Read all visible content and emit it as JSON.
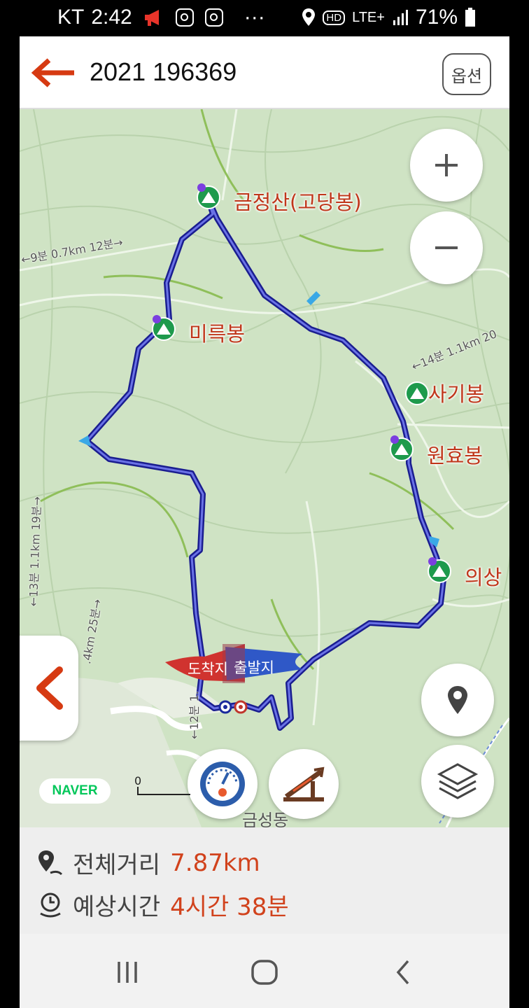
{
  "status_bar": {
    "carrier": "KT",
    "time": "2:42",
    "network": "LTE+",
    "hd": "HD",
    "battery": "71%"
  },
  "header": {
    "title": "2021 196369",
    "option_label": "옵션"
  },
  "map": {
    "peaks": [
      {
        "name": "금정산(고당봉)"
      },
      {
        "name": "미륵봉"
      },
      {
        "name": "사기봉"
      },
      {
        "name": "원효봉"
      },
      {
        "name": "의상"
      }
    ],
    "trail_labels": [
      "←9분 0.7km 12분→",
      "←14분 1.1km 20",
      "←13분 1.1km 19분→",
      ".4km 25분→",
      "←12분 1."
    ],
    "arrival_label": "도착지",
    "departure_label": "출발지",
    "naver_label": "NAVER",
    "scale_label": "0",
    "place_fragment": "금성동"
  },
  "summary": {
    "distance_label": "전체거리",
    "distance_value": "7.87km",
    "time_label": "예상시간",
    "time_value": "4시간 38분"
  },
  "colors": {
    "accent": "#d1421c",
    "route": "#2a2fbf",
    "map_bg": "#cfe3c4",
    "peak_marker": "#1e9a4c"
  }
}
